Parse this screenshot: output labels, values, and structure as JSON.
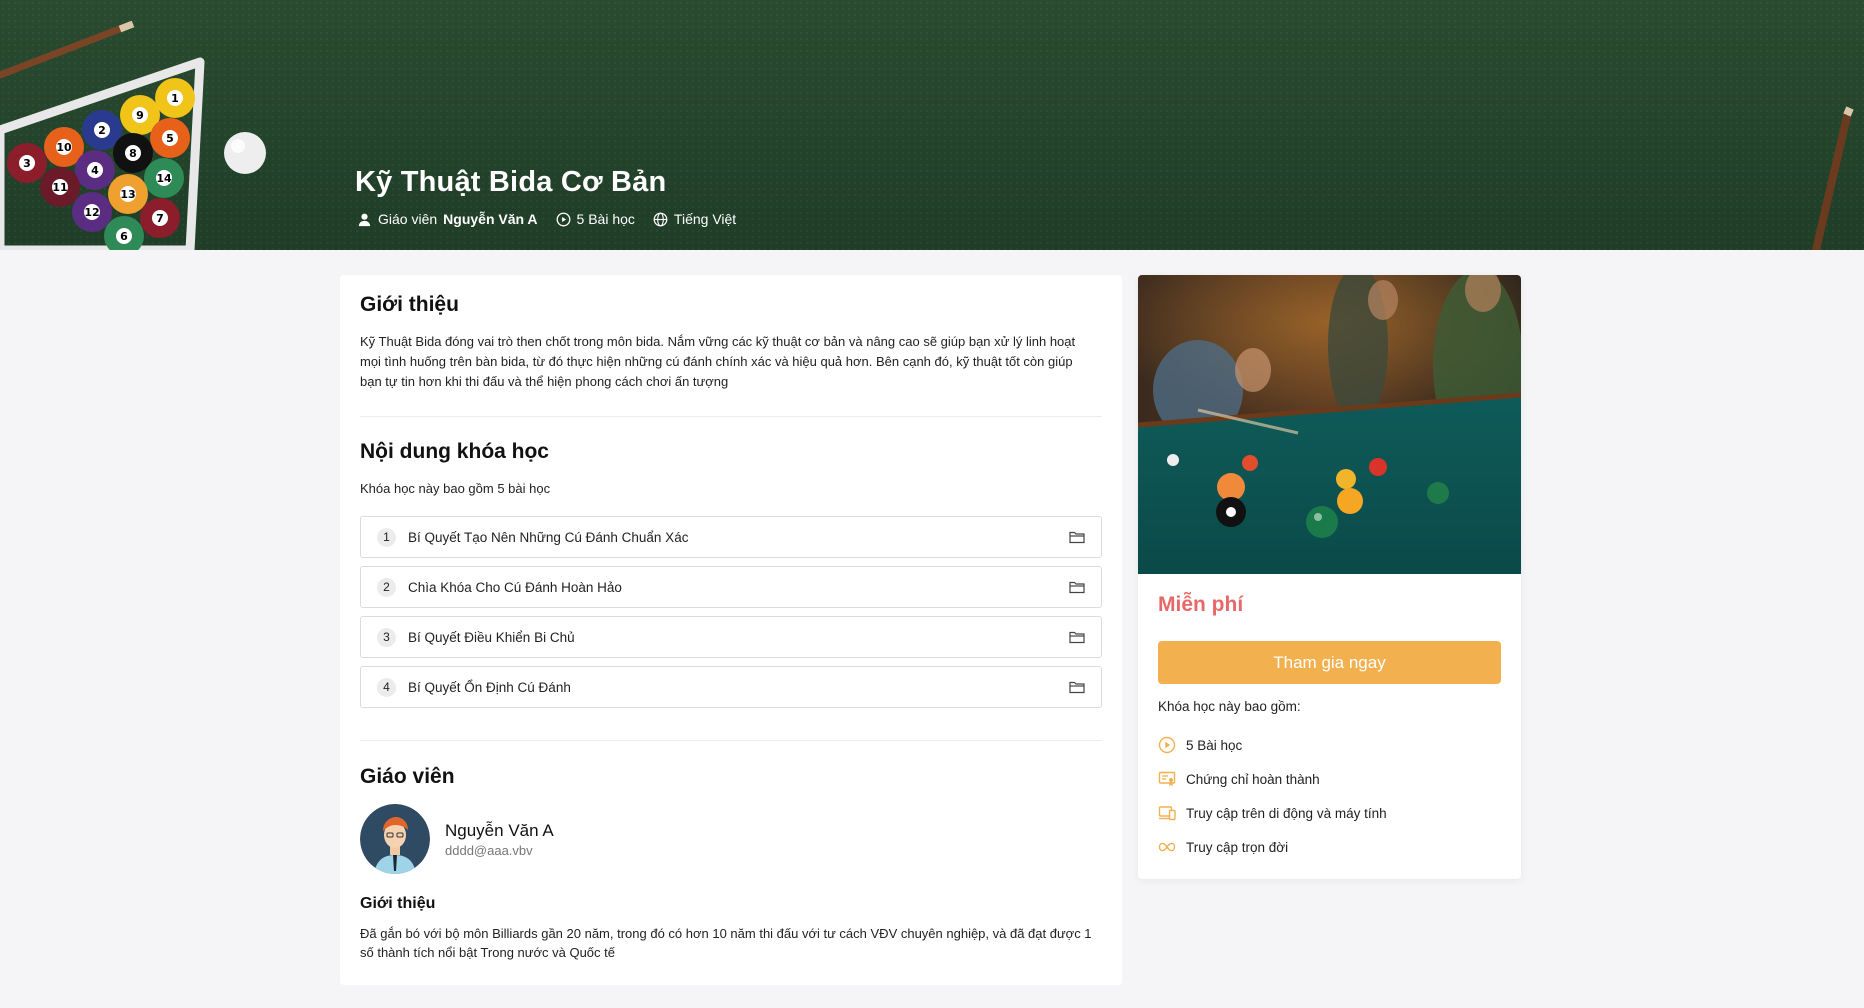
{
  "hero": {
    "title": "Kỹ Thuật Bida Cơ Bản",
    "teacher_prefix": "Giáo viên",
    "teacher_name": "Nguyễn Văn A",
    "lessons_count": "5 Bài học",
    "language": "Tiếng Việt"
  },
  "intro": {
    "title": "Giới thiệu",
    "text": "Kỹ Thuật Bida đóng vai trò then chốt trong môn bida. Nắm vững các kỹ thuật cơ bản và nâng cao sẽ giúp bạn xử lý linh hoạt mọi tình huống trên bàn bida, từ đó thực hiện những cú đánh chính xác và hiệu quả hơn. Bên cạnh đó, kỹ thuật tốt còn giúp bạn tự tin hơn khi thi đấu và thể hiện phong cách chơi ấn tượng"
  },
  "content": {
    "title": "Nội dung khóa học",
    "subtitle": "Khóa học này bao gồm 5 bài học",
    "lessons": [
      {
        "num": "1",
        "title": "Bí Quyết Tạo Nên Những Cú Đánh Chuẩn Xác"
      },
      {
        "num": "2",
        "title": "Chìa Khóa Cho Cú Đánh Hoàn Hảo"
      },
      {
        "num": "3",
        "title": "Bí Quyết Điều Khiển Bi Chủ"
      },
      {
        "num": "4",
        "title": "Bí Quyết Ổn Định Cú Đánh"
      }
    ]
  },
  "teacher": {
    "title": "Giáo viên",
    "name": "Nguyễn Văn A",
    "email": "dddd@aaa.vbv",
    "bio_title": "Giới thiệu",
    "bio_text": "Đã gắn bó với bộ môn Billiards gần 20 năm, trong đó có hơn 10 năm thi đấu với tư cách VĐV chuyên nghiệp, và đã đạt được 1 số thành tích nổi bật Trong nước và Quốc tế"
  },
  "sidebar": {
    "price": "Miễn phí",
    "join_label": "Tham gia ngay",
    "includes_title": "Khóa học này bao gồm:",
    "includes": [
      {
        "icon": "play-circle-icon",
        "label": "5 Bài học"
      },
      {
        "icon": "certificate-icon",
        "label": "Chứng chỉ hoàn thành"
      },
      {
        "icon": "devices-icon",
        "label": "Truy cập trên di động và máy tính"
      },
      {
        "icon": "infinity-icon",
        "label": "Truy cập trọn đời"
      }
    ]
  },
  "colors": {
    "hero_bg": "#25452d",
    "accent_orange": "#f2b04f",
    "price_red": "#e8686a"
  }
}
